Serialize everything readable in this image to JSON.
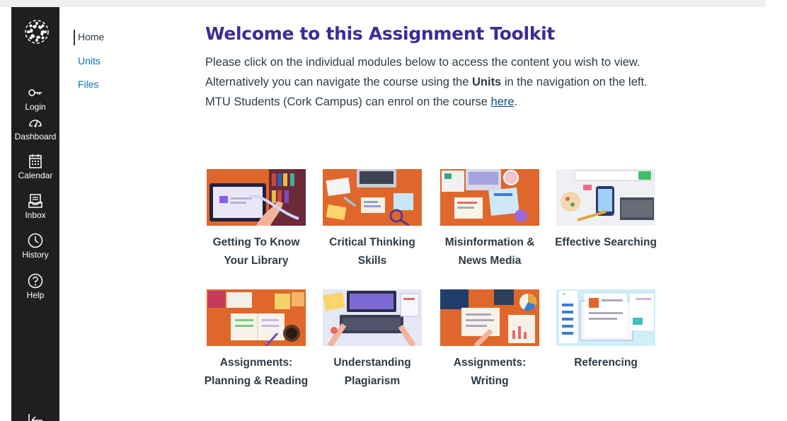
{
  "global_nav": {
    "items": [
      {
        "label": "Login",
        "icon": "key-icon"
      },
      {
        "label": "Dashboard",
        "icon": "dashboard-icon"
      },
      {
        "label": "Calendar",
        "icon": "calendar-icon"
      },
      {
        "label": "Inbox",
        "icon": "inbox-icon"
      },
      {
        "label": "History",
        "icon": "clock-icon"
      },
      {
        "label": "Help",
        "icon": "help-icon"
      }
    ]
  },
  "course_nav": {
    "items": [
      {
        "label": "Home",
        "active": true
      },
      {
        "label": "Units",
        "active": false
      },
      {
        "label": "Files",
        "active": false
      }
    ]
  },
  "main": {
    "title": "Welcome to this Assignment Toolkit",
    "intro_part1": "Please click on the individual modules below to access the content you wish to view. Alternatively you can navigate the course using the ",
    "intro_bold": "Units",
    "intro_part2": " in the navigation on the left. MTU Students (Cork Campus) can enrol on the course ",
    "intro_link": "here",
    "intro_part3": ".",
    "modules": [
      {
        "label": "Getting To Know Your Library"
      },
      {
        "label": "Critical Thinking Skills"
      },
      {
        "label": "Misinformation & News Media"
      },
      {
        "label": "Effective Searching"
      },
      {
        "label": "Assignments: Planning & Reading"
      },
      {
        "label": "Understanding Plagiarism"
      },
      {
        "label": "Assignments: Writing"
      },
      {
        "label": "Referencing"
      }
    ]
  },
  "colors": {
    "nav_bg": "#1f1f1f",
    "title": "#3d2b97",
    "link": "#0374b5",
    "desk_orange": "#e0672c"
  }
}
